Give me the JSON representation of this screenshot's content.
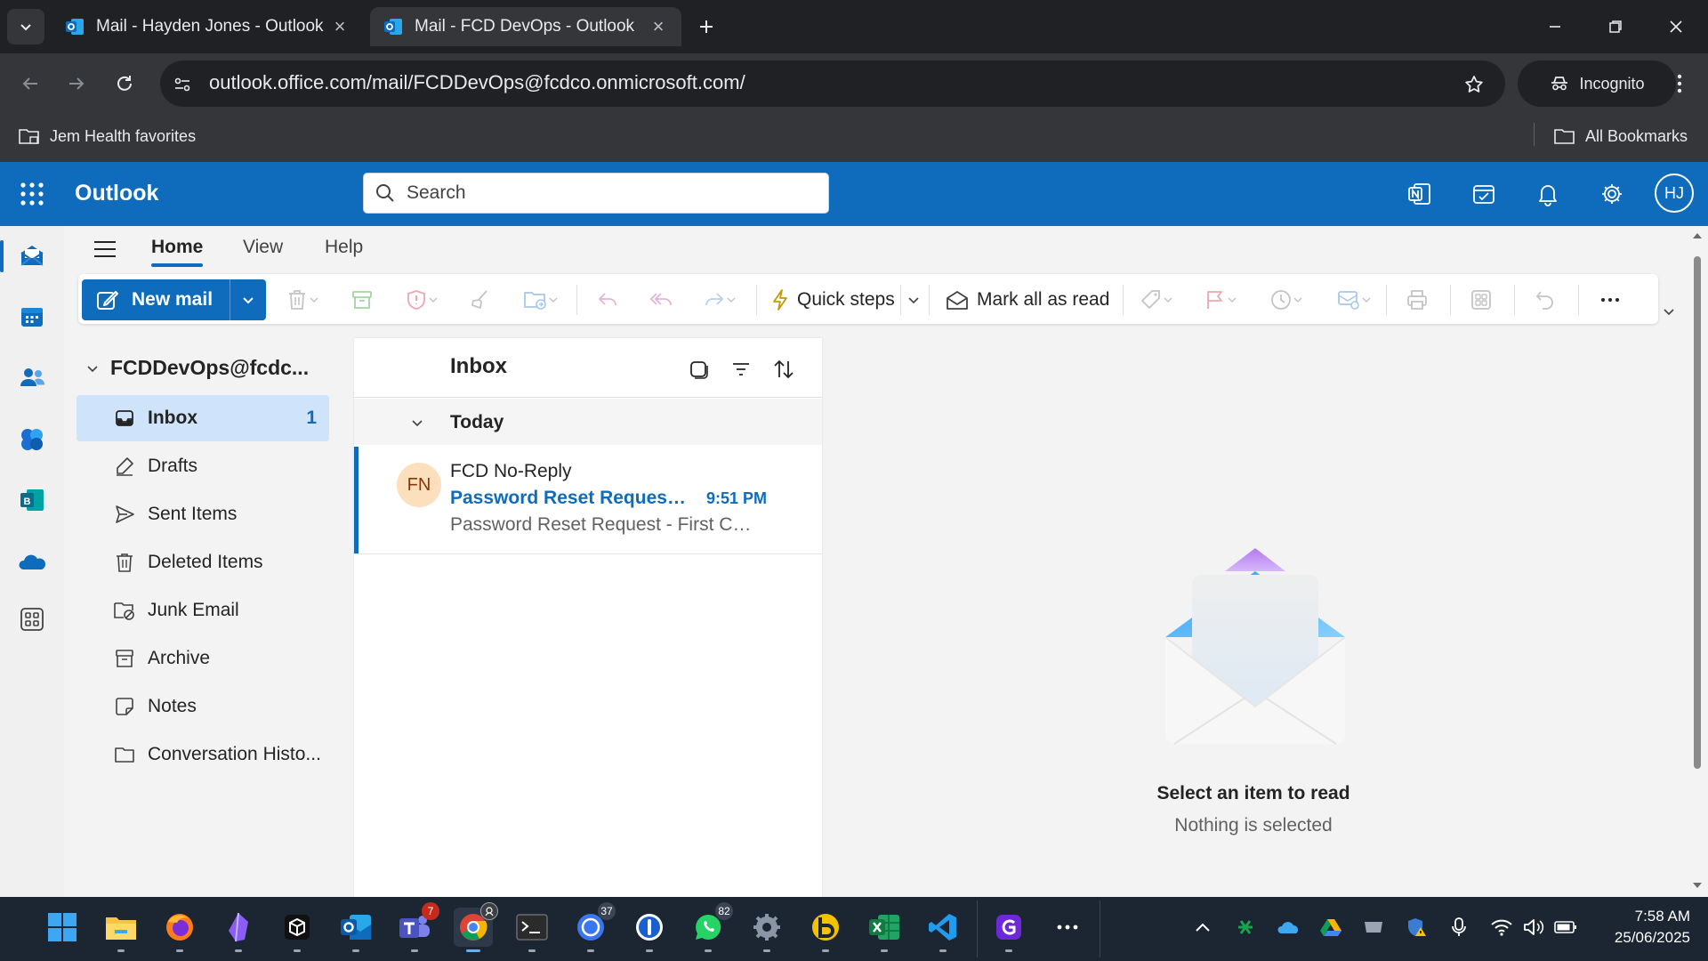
{
  "browser": {
    "tabs": [
      {
        "title": "Mail - Hayden Jones - Outlook",
        "active": false
      },
      {
        "title": "Mail - FCD DevOps - Outlook",
        "active": true
      }
    ],
    "url": "outlook.office.com/mail/FCDDevOps@fcdco.onmicrosoft.com/",
    "profile_label": "Incognito",
    "bookmarks": {
      "left": "Jem Health favorites",
      "right": "All Bookmarks"
    }
  },
  "outlook": {
    "brand": "Outlook",
    "search_placeholder": "Search",
    "user_initials": "HJ",
    "accent_color": "#0f6cbd"
  },
  "ribbon": {
    "tabs": [
      "Home",
      "View",
      "Help"
    ],
    "active_tab": "Home",
    "new_mail_label": "New mail",
    "quick_steps_label": "Quick steps",
    "mark_all_read_label": "Mark all as read"
  },
  "folders": {
    "account": "FCDDevOps@fcdc...",
    "items": [
      {
        "label": "Inbox",
        "count": "1",
        "icon": "inbox-icon",
        "selected": true
      },
      {
        "label": "Drafts",
        "count": "",
        "icon": "drafts-icon"
      },
      {
        "label": "Sent Items",
        "count": "",
        "icon": "send-icon"
      },
      {
        "label": "Deleted Items",
        "count": "",
        "icon": "trash-icon"
      },
      {
        "label": "Junk Email",
        "count": "",
        "icon": "junk-icon"
      },
      {
        "label": "Archive",
        "count": "",
        "icon": "archive-icon"
      },
      {
        "label": "Notes",
        "count": "",
        "icon": "note-icon"
      },
      {
        "label": "Conversation Histo...",
        "count": "",
        "icon": "folder-icon"
      }
    ]
  },
  "message_list": {
    "title": "Inbox",
    "group_label": "Today",
    "messages": [
      {
        "initials": "FN",
        "sender": "FCD No-Reply",
        "subject": "Password Reset Request -...",
        "time": "9:51 PM",
        "preview": "Password Reset Request - First Choi...",
        "unread": true
      }
    ]
  },
  "reading_pane": {
    "empty_title": "Select an item to read",
    "empty_subtitle": "Nothing is selected"
  },
  "taskbar": {
    "badges": {
      "teams": "7",
      "signal": "37",
      "whatsapp": "82"
    },
    "time": "7:58 AM",
    "date": "25/06/2025"
  }
}
